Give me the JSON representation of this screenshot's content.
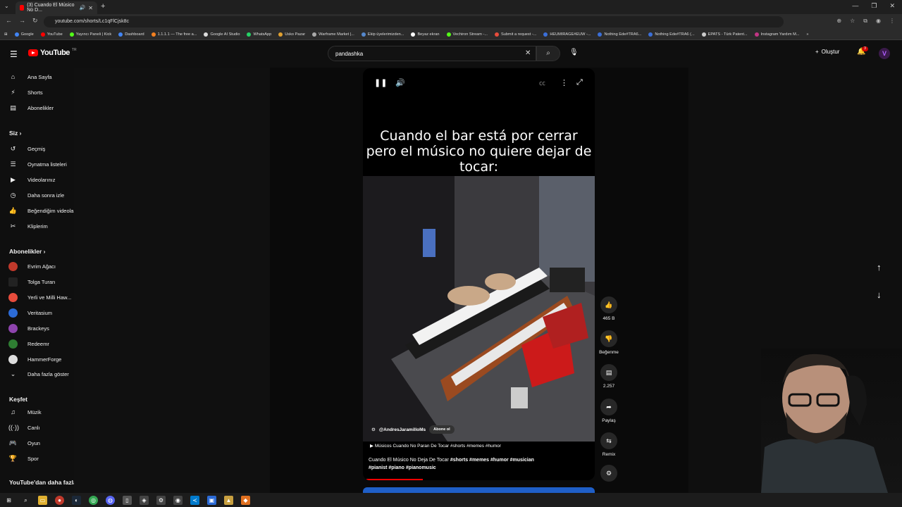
{
  "browser": {
    "tab_title": "(3) Cuando El Músico No D...",
    "url": "youtube.com/shorts/Lc1qFlCjsk8c",
    "bookmarks": [
      "Google",
      "YouTube",
      "Yayıncı Paneli | Kick",
      "Dashboard",
      "1.1.1.1 — The free a...",
      "Google AI Studio",
      "WhatsApp",
      "Usko Pazar",
      "Warframe Market |...",
      "Ekip üyelerimizden...",
      "Beyaz ekran",
      "Vechiron Stream -...",
      "Submit a request -...",
      "HEUMIRAGE#EUW -...",
      "Nothing Ede#TRA6...",
      "Nothing Ede#TRA6 (...",
      "EPATS - Türk Patent...",
      "Instagram Yardım M..."
    ]
  },
  "header": {
    "logo": "YouTube",
    "logo_region": "TR",
    "search_value": "pandashka",
    "create_label": "Oluştur",
    "notif_count": "3",
    "avatar_letter": "V"
  },
  "sidebar": {
    "main": [
      "Ana Sayfa",
      "Shorts",
      "Abonelikler"
    ],
    "you_header": "Siz",
    "you": [
      "Geçmiş",
      "Oynatma listeleri",
      "Videolarınız",
      "Daha sonra izle",
      "Beğendiğim videolar",
      "Kliplerim"
    ],
    "subs_header": "Abonelikler",
    "subs": [
      "Evrim Ağacı",
      "Tolga Turan",
      "Yerli ve Milli Haw...",
      "Veritasium",
      "Brackeys",
      "Redeemr",
      "HammerForge",
      "Daha fazla göster"
    ],
    "explore_header": "Keşfet",
    "explore": [
      "Müzik",
      "Canlı",
      "Oyun",
      "Spor"
    ],
    "more_header": "YouTube'dan daha fazla..."
  },
  "video": {
    "caption": "Cuando el bar está por cerrar pero el músico no quiere dejar de tocar:",
    "channel": "@AndresJaramilloMs",
    "subscribe": "Abone ol",
    "music": "Músicos Cuando No Paran De Tocar #shorts #memes #humor",
    "title": "Cuando El Músico No Deja De Tocar",
    "title_tags_1": "#shorts #memes #humor #musician",
    "title_tags_2": "#pianist #piano #pianomusic",
    "progress": 0.25
  },
  "actions": {
    "likes": "465 B",
    "dislike": "Beğenme",
    "comments": "2.257",
    "share": "Paylaş",
    "remix": "Remix"
  }
}
